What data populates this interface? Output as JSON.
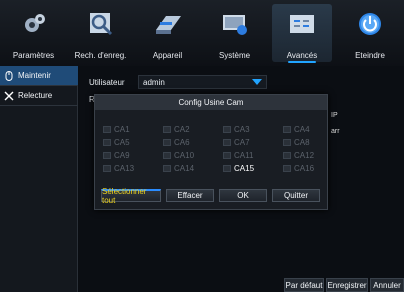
{
  "nav": {
    "items": [
      {
        "label": "Paramètres",
        "icon": "gear-icon"
      },
      {
        "label": "Rech. d'enreg.",
        "icon": "search-icon"
      },
      {
        "label": "Appareil",
        "icon": "harddisk-icon"
      },
      {
        "label": "Système",
        "icon": "monitor-icon"
      },
      {
        "label": "Avancés",
        "icon": "advanced-icon"
      },
      {
        "label": "Eteindre",
        "icon": "power-icon"
      }
    ],
    "active": "Avancés"
  },
  "sidebar": {
    "items": [
      {
        "label": "Maintenir",
        "icon": "mouse-icon"
      },
      {
        "label": "Relecture",
        "icon": "tools-icon"
      }
    ]
  },
  "main": {
    "user_label": "Utilisateur",
    "user_value": "admin",
    "bg_letter": "R",
    "bg_frag_ip": "IP",
    "bg_frag_arr": "arr"
  },
  "footer": {
    "default_label": "Par défaut",
    "save_label": "Enregistrer",
    "cancel_label": "Annuler"
  },
  "dialog": {
    "title": "Config Usine Cam",
    "cameras": [
      "CA1",
      "CA2",
      "CA3",
      "CA4",
      "CA5",
      "CA6",
      "CA7",
      "CA8",
      "CA9",
      "CA10",
      "CA11",
      "CA12",
      "CA13",
      "CA14",
      "CA15",
      "CA16"
    ],
    "highlighted": "CA15",
    "select_all_label": "Sélectionner tout",
    "clear_label": "Effacer",
    "ok_label": "OK",
    "exit_label": "Quitter"
  },
  "colors": {
    "accent": "#21a4ff",
    "select_all_text": "#f2d61b"
  }
}
